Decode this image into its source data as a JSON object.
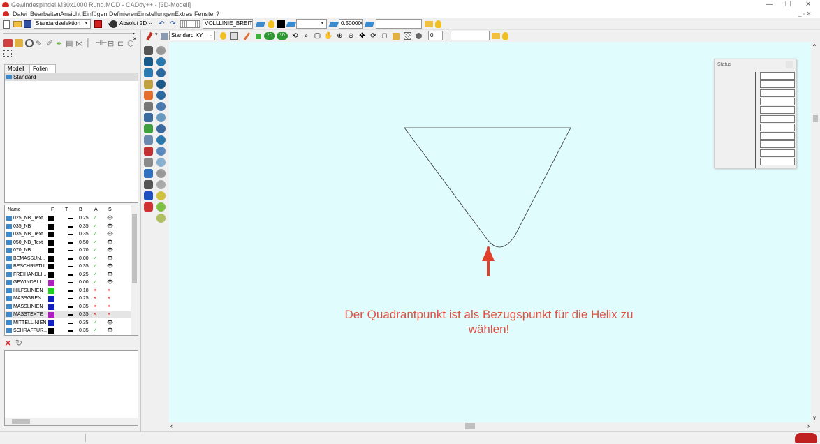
{
  "window": {
    "title": "Gewindespindel M30x1000 Rund.MOD - CADdy++ - [3D-Modell]",
    "minimize": "—",
    "restore": "❐",
    "close": "✕"
  },
  "menu": {
    "items": [
      "Datei",
      "Bearbeiten",
      "Ansicht",
      "Einfügen",
      "Definieren",
      "Einstellungen",
      "Extras",
      "Fenster",
      "?"
    ],
    "mdi_controls": "_ ▫ ✕"
  },
  "toolbar": {
    "selection_mode": "Standardselektion",
    "coord_mode": "Absolut 2D",
    "line_type": "VOLLLINIE_BREIT",
    "line_width": "0.500000",
    "numeric_value": "0",
    "view": "Standard XY"
  },
  "left_panel": {
    "tabs": [
      "Modell",
      "Folien"
    ],
    "active_tab": "Folien",
    "folien": [
      "Standard"
    ],
    "layer_columns": [
      "Name",
      "F",
      "T",
      "B",
      "A",
      "S"
    ],
    "layers": [
      {
        "name": "025_NB_Text",
        "color": "#000000",
        "width": "0.25",
        "active": "✓",
        "visible": "👁"
      },
      {
        "name": "035_NB",
        "color": "#000000",
        "width": "0.35",
        "active": "✓",
        "visible": "👁"
      },
      {
        "name": "035_NB_Text",
        "color": "#000000",
        "width": "0.35",
        "active": "✓",
        "visible": "👁"
      },
      {
        "name": "050_NB_Text",
        "color": "#000000",
        "width": "0.50",
        "active": "✓",
        "visible": "👁"
      },
      {
        "name": "070_NB",
        "color": "#000000",
        "width": "0.70",
        "active": "✓",
        "visible": "👁"
      },
      {
        "name": "BEMASSUN...",
        "color": "#000000",
        "width": "0.00",
        "active": "✓",
        "visible": "👁"
      },
      {
        "name": "BESCHRIFTU...",
        "color": "#000000",
        "width": "0.35",
        "active": "✓",
        "visible": "👁"
      },
      {
        "name": "FREIHANDLI...",
        "color": "#000000",
        "width": "0.25",
        "active": "✓",
        "visible": "👁"
      },
      {
        "name": "GEWINDELI...",
        "color": "#b020c0",
        "width": "0.00",
        "active": "✓",
        "visible": "👁"
      },
      {
        "name": "HILFSLINIEN",
        "color": "#20d020",
        "width": "0.18",
        "active": "✕",
        "visible": "✕"
      },
      {
        "name": "MASSGREN...",
        "color": "#1020c0",
        "width": "0.25",
        "active": "✕",
        "visible": "✕"
      },
      {
        "name": "MASSLINIEN",
        "color": "#1020c0",
        "width": "0.35",
        "active": "✕",
        "visible": "✕"
      },
      {
        "name": "MASSTEXTE",
        "color": "#b020c0",
        "width": "0.35",
        "active": "✕",
        "visible": "✕"
      },
      {
        "name": "MITTELLINIEN",
        "color": "#1020c0",
        "width": "0.35",
        "active": "✓",
        "visible": "👁"
      },
      {
        "name": "SCHRAFFUR...",
        "color": "#000000",
        "width": "0.35",
        "active": "✓",
        "visible": "👁"
      }
    ]
  },
  "status_panel": {
    "title": "Status"
  },
  "annotation": {
    "text": "Der Quadrantpunkt ist als Bezugspunkt für die Helix zu wählen!",
    "color": "#e04030"
  }
}
